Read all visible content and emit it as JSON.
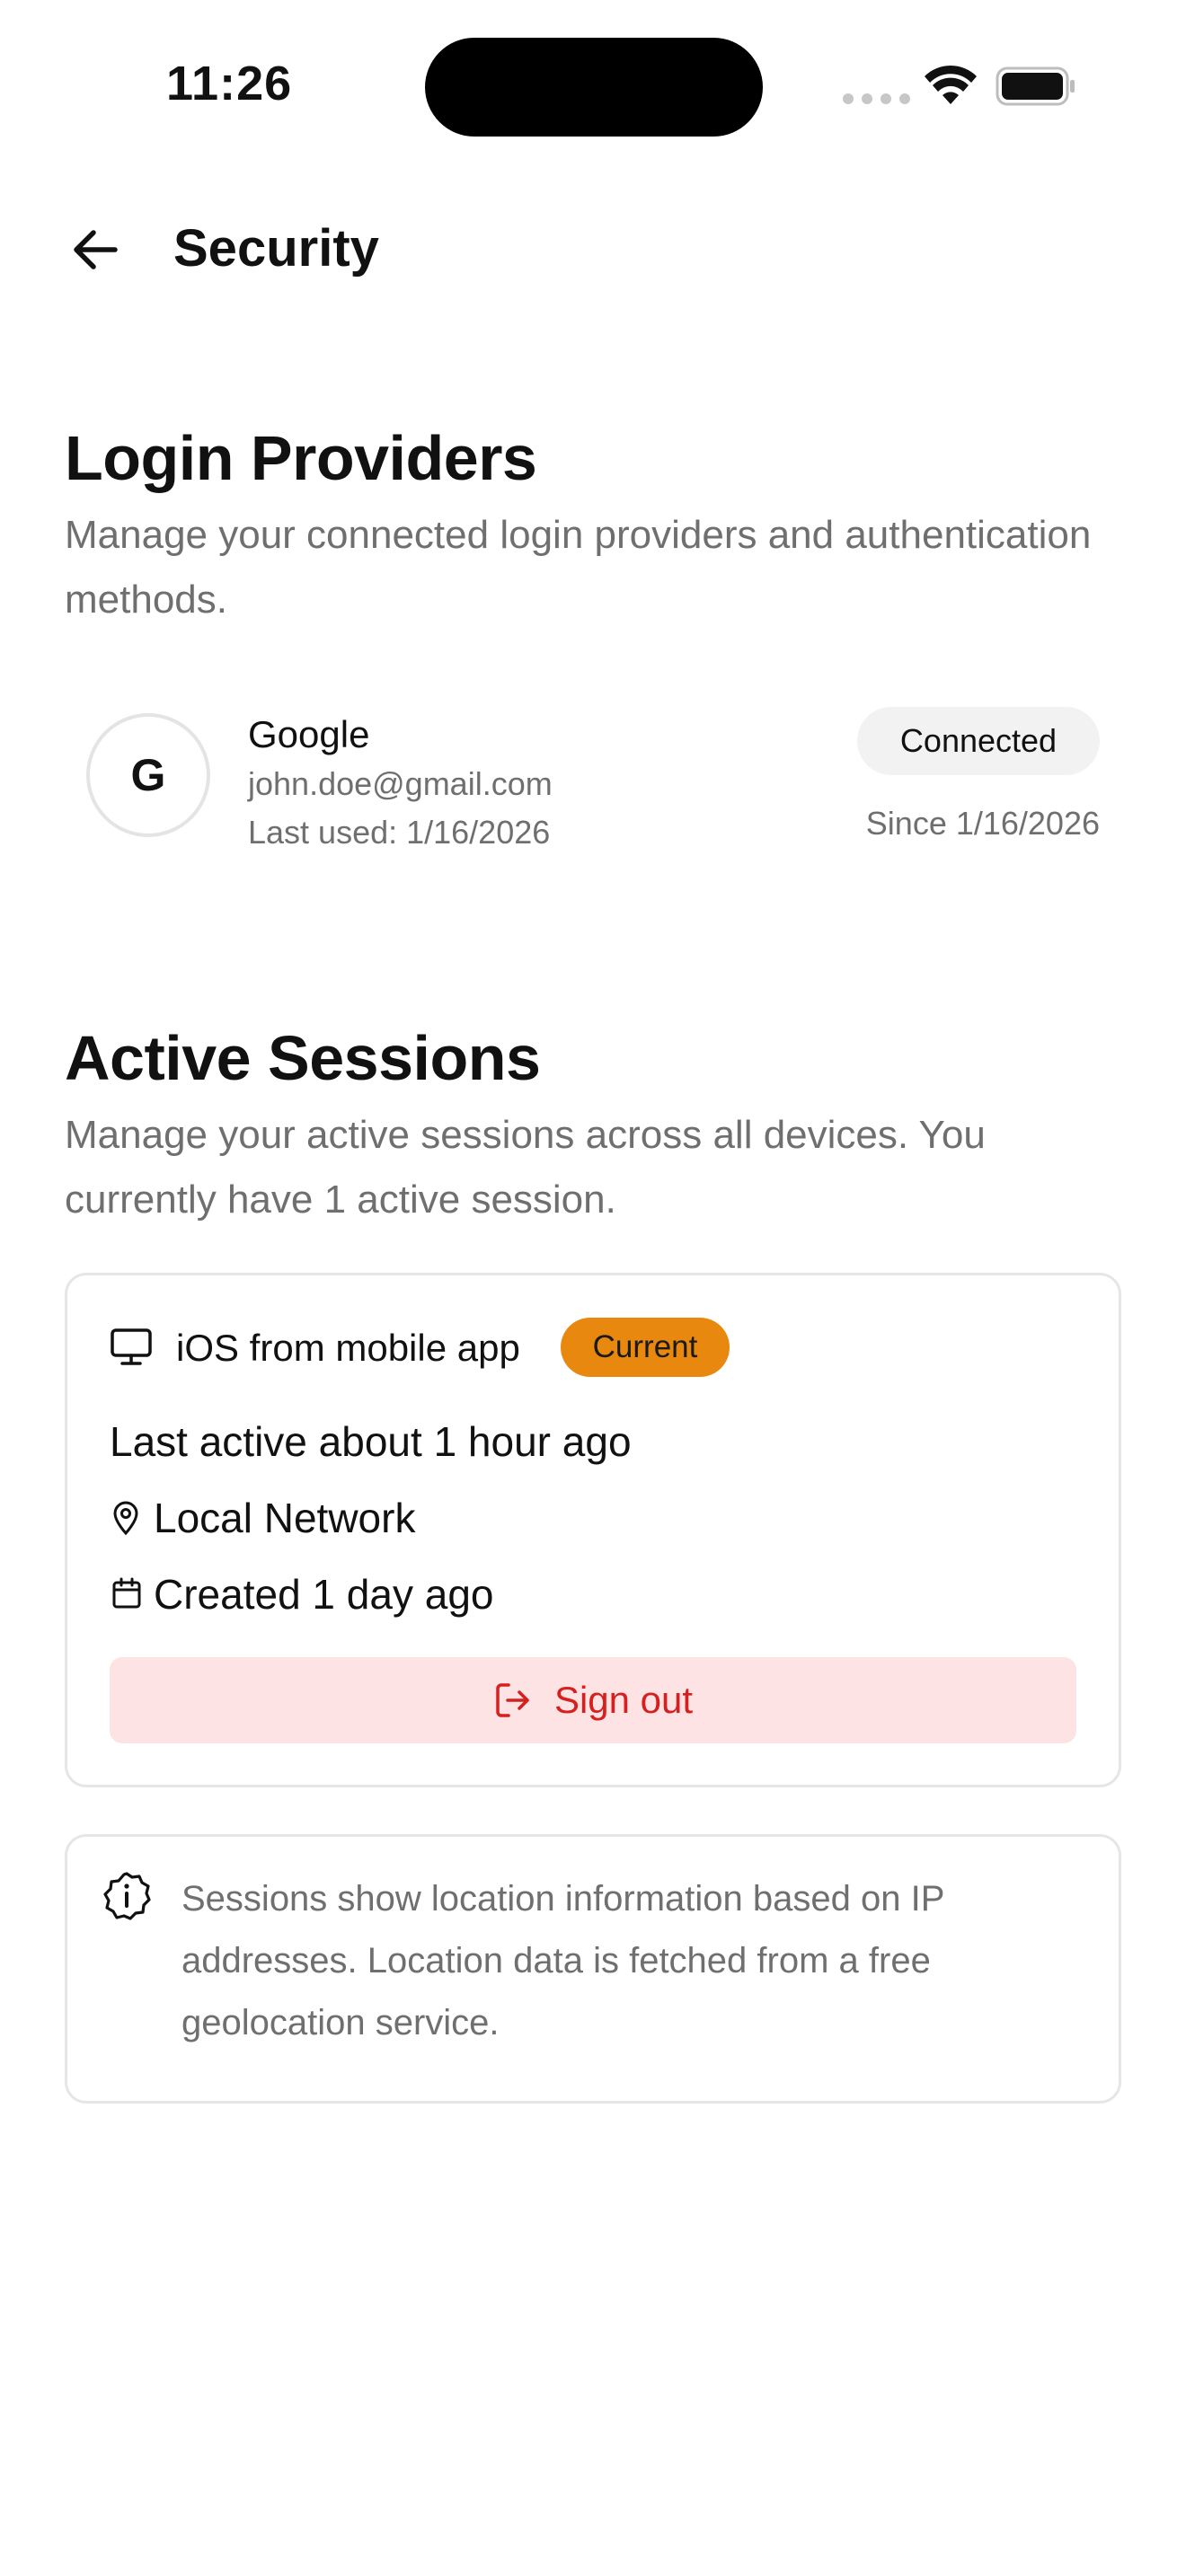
{
  "status_bar": {
    "time": "11:26"
  },
  "header": {
    "title": "Security"
  },
  "login_providers": {
    "title": "Login Providers",
    "description": "Manage your connected login providers and authentication methods.",
    "providers": [
      {
        "initial": "G",
        "name": "Google",
        "email": "john.doe@gmail.com",
        "last_used": "Last used: 1/16/2026",
        "status": "Connected",
        "since": "Since 1/16/2026"
      }
    ]
  },
  "active_sessions": {
    "title": "Active Sessions",
    "description": "Manage your active sessions across all devices. You currently have 1 active session.",
    "sessions": [
      {
        "device": "iOS from mobile app",
        "badge": "Current",
        "last_active": "Last active about 1 hour ago",
        "location": "Local Network",
        "created": "Created 1 day ago",
        "sign_out_label": "Sign out"
      }
    ],
    "info": "Sessions show location information based on IP addresses. Location data is fetched from a free geolocation service."
  },
  "colors": {
    "accent_orange": "#e8880e",
    "danger_red": "#d61f1f",
    "danger_bg": "#fde3e4",
    "muted_text": "#6f6f6f"
  },
  "icons": {
    "back": "arrow-left-icon",
    "device": "monitor-icon",
    "location": "map-pin-icon",
    "created": "calendar-icon",
    "sign_out": "log-out-icon",
    "info": "info-badge-icon"
  }
}
